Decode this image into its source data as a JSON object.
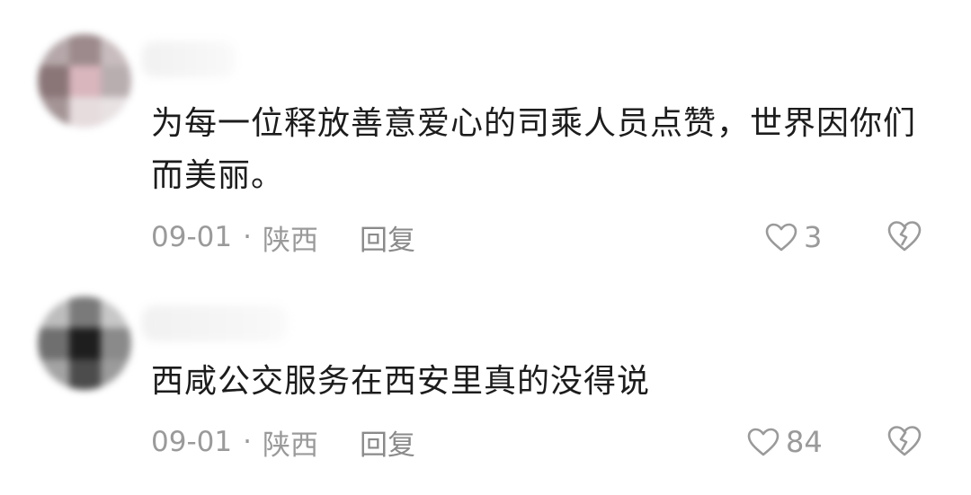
{
  "comments": [
    {
      "text": "为每一位释放善意爱心的司乘人员点赞，世界因你们而美丽。",
      "date": "09-01",
      "separator": "·",
      "location": "陕西",
      "reply_label": "回复",
      "like_count": "3",
      "like_icon": "heart-outline",
      "dislike_icon": "broken-heart"
    },
    {
      "text": "西咸公交服务在西安里真的没得说",
      "date": "09-01",
      "separator": "·",
      "location": "陕西",
      "reply_label": "回复",
      "like_count": "84",
      "like_icon": "heart-outline",
      "dislike_icon": "broken-heart"
    }
  ],
  "colors": {
    "text": "#1c1c1c",
    "meta": "#9a9a9a",
    "background": "#ffffff"
  }
}
